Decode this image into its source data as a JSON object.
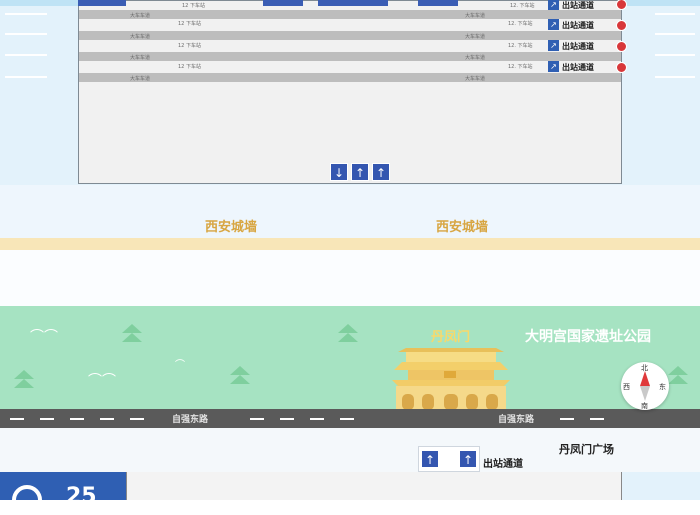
{
  "station": {
    "platform_rows": [
      {
        "left": "12 下车站",
        "right": "12.  下车站",
        "mid": "大车车道",
        "exit": "出站通道"
      },
      {
        "left": "12 下车站",
        "right": "12.  下车站",
        "mid": "大车车道",
        "exit": "出站通道"
      },
      {
        "left": "12 下车站",
        "right": "12.  下车站",
        "mid": "大车车道",
        "exit": "出站通道"
      },
      {
        "left": "12 下车站",
        "right": "12.  下车站",
        "mid": "大车车道",
        "exit": "出站通道"
      }
    ],
    "arrow_glyphs": [
      "↓",
      "↑",
      "↑"
    ]
  },
  "wall": {
    "label_left": "西安城墙",
    "label_right": "西安城墙"
  },
  "park": {
    "name": "大明宫国家遗址公园",
    "gate": "丹凤门",
    "road_left": "自强东路",
    "road_right": "自强东路"
  },
  "plaza": {
    "label": "丹凤门广场",
    "exit": "出站通道",
    "arrows": [
      "↑",
      "↑"
    ]
  },
  "compass": {
    "north": "北",
    "south": "南",
    "east": "东",
    "west": "西"
  },
  "badge": {
    "number": "25"
  },
  "colors": {
    "accent": "#2f5fb3",
    "wall": "#d8a642",
    "park": "#a6e3c2",
    "road": "#5a5a5a"
  }
}
